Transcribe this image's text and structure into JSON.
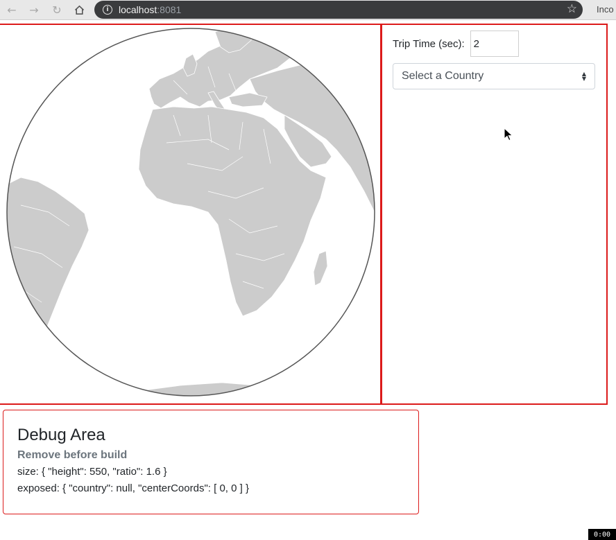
{
  "browser": {
    "url_host": "localhost",
    "url_port": ":8081",
    "incognito_label": "Inco"
  },
  "controls": {
    "trip_time_label": "Trip Time (sec):",
    "trip_time_value": "2",
    "country_select_placeholder": "Select a Country"
  },
  "debug": {
    "title": "Debug Area",
    "subtitle": "Remove before build",
    "size_line": "size: { \"height\": 550, \"ratio\": 1.6 }",
    "exposed_line": "exposed: { \"country\": null, \"centerCoords\": [ 0, 0 ] }"
  },
  "recording_timer": "0:00",
  "colors": {
    "pane_border": "#dc1a1a",
    "land": "#cccccc",
    "ocean": "#ffffff"
  }
}
